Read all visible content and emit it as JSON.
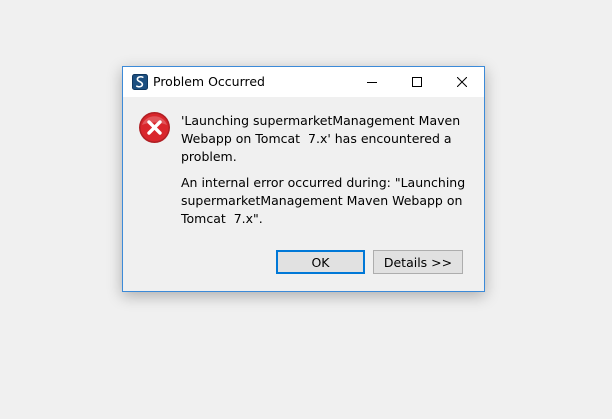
{
  "dialog": {
    "title": "Problem Occurred",
    "message_primary": "'Launching supermarketManagement Maven Webapp on Tomcat  7.x' has encountered a problem.",
    "message_detail": "An internal error occurred during: \"Launching supermarketManagement Maven Webapp on Tomcat  7.x\".",
    "ok_label": "OK",
    "details_label": "Details >>",
    "app_icon": "eclipse-sts-icon",
    "status_icon": "error-icon"
  },
  "colors": {
    "background": "#f0f0f0",
    "dialog_border": "#3c8ad8",
    "error_red": "#d9262c",
    "focus_border": "#0078d7"
  }
}
